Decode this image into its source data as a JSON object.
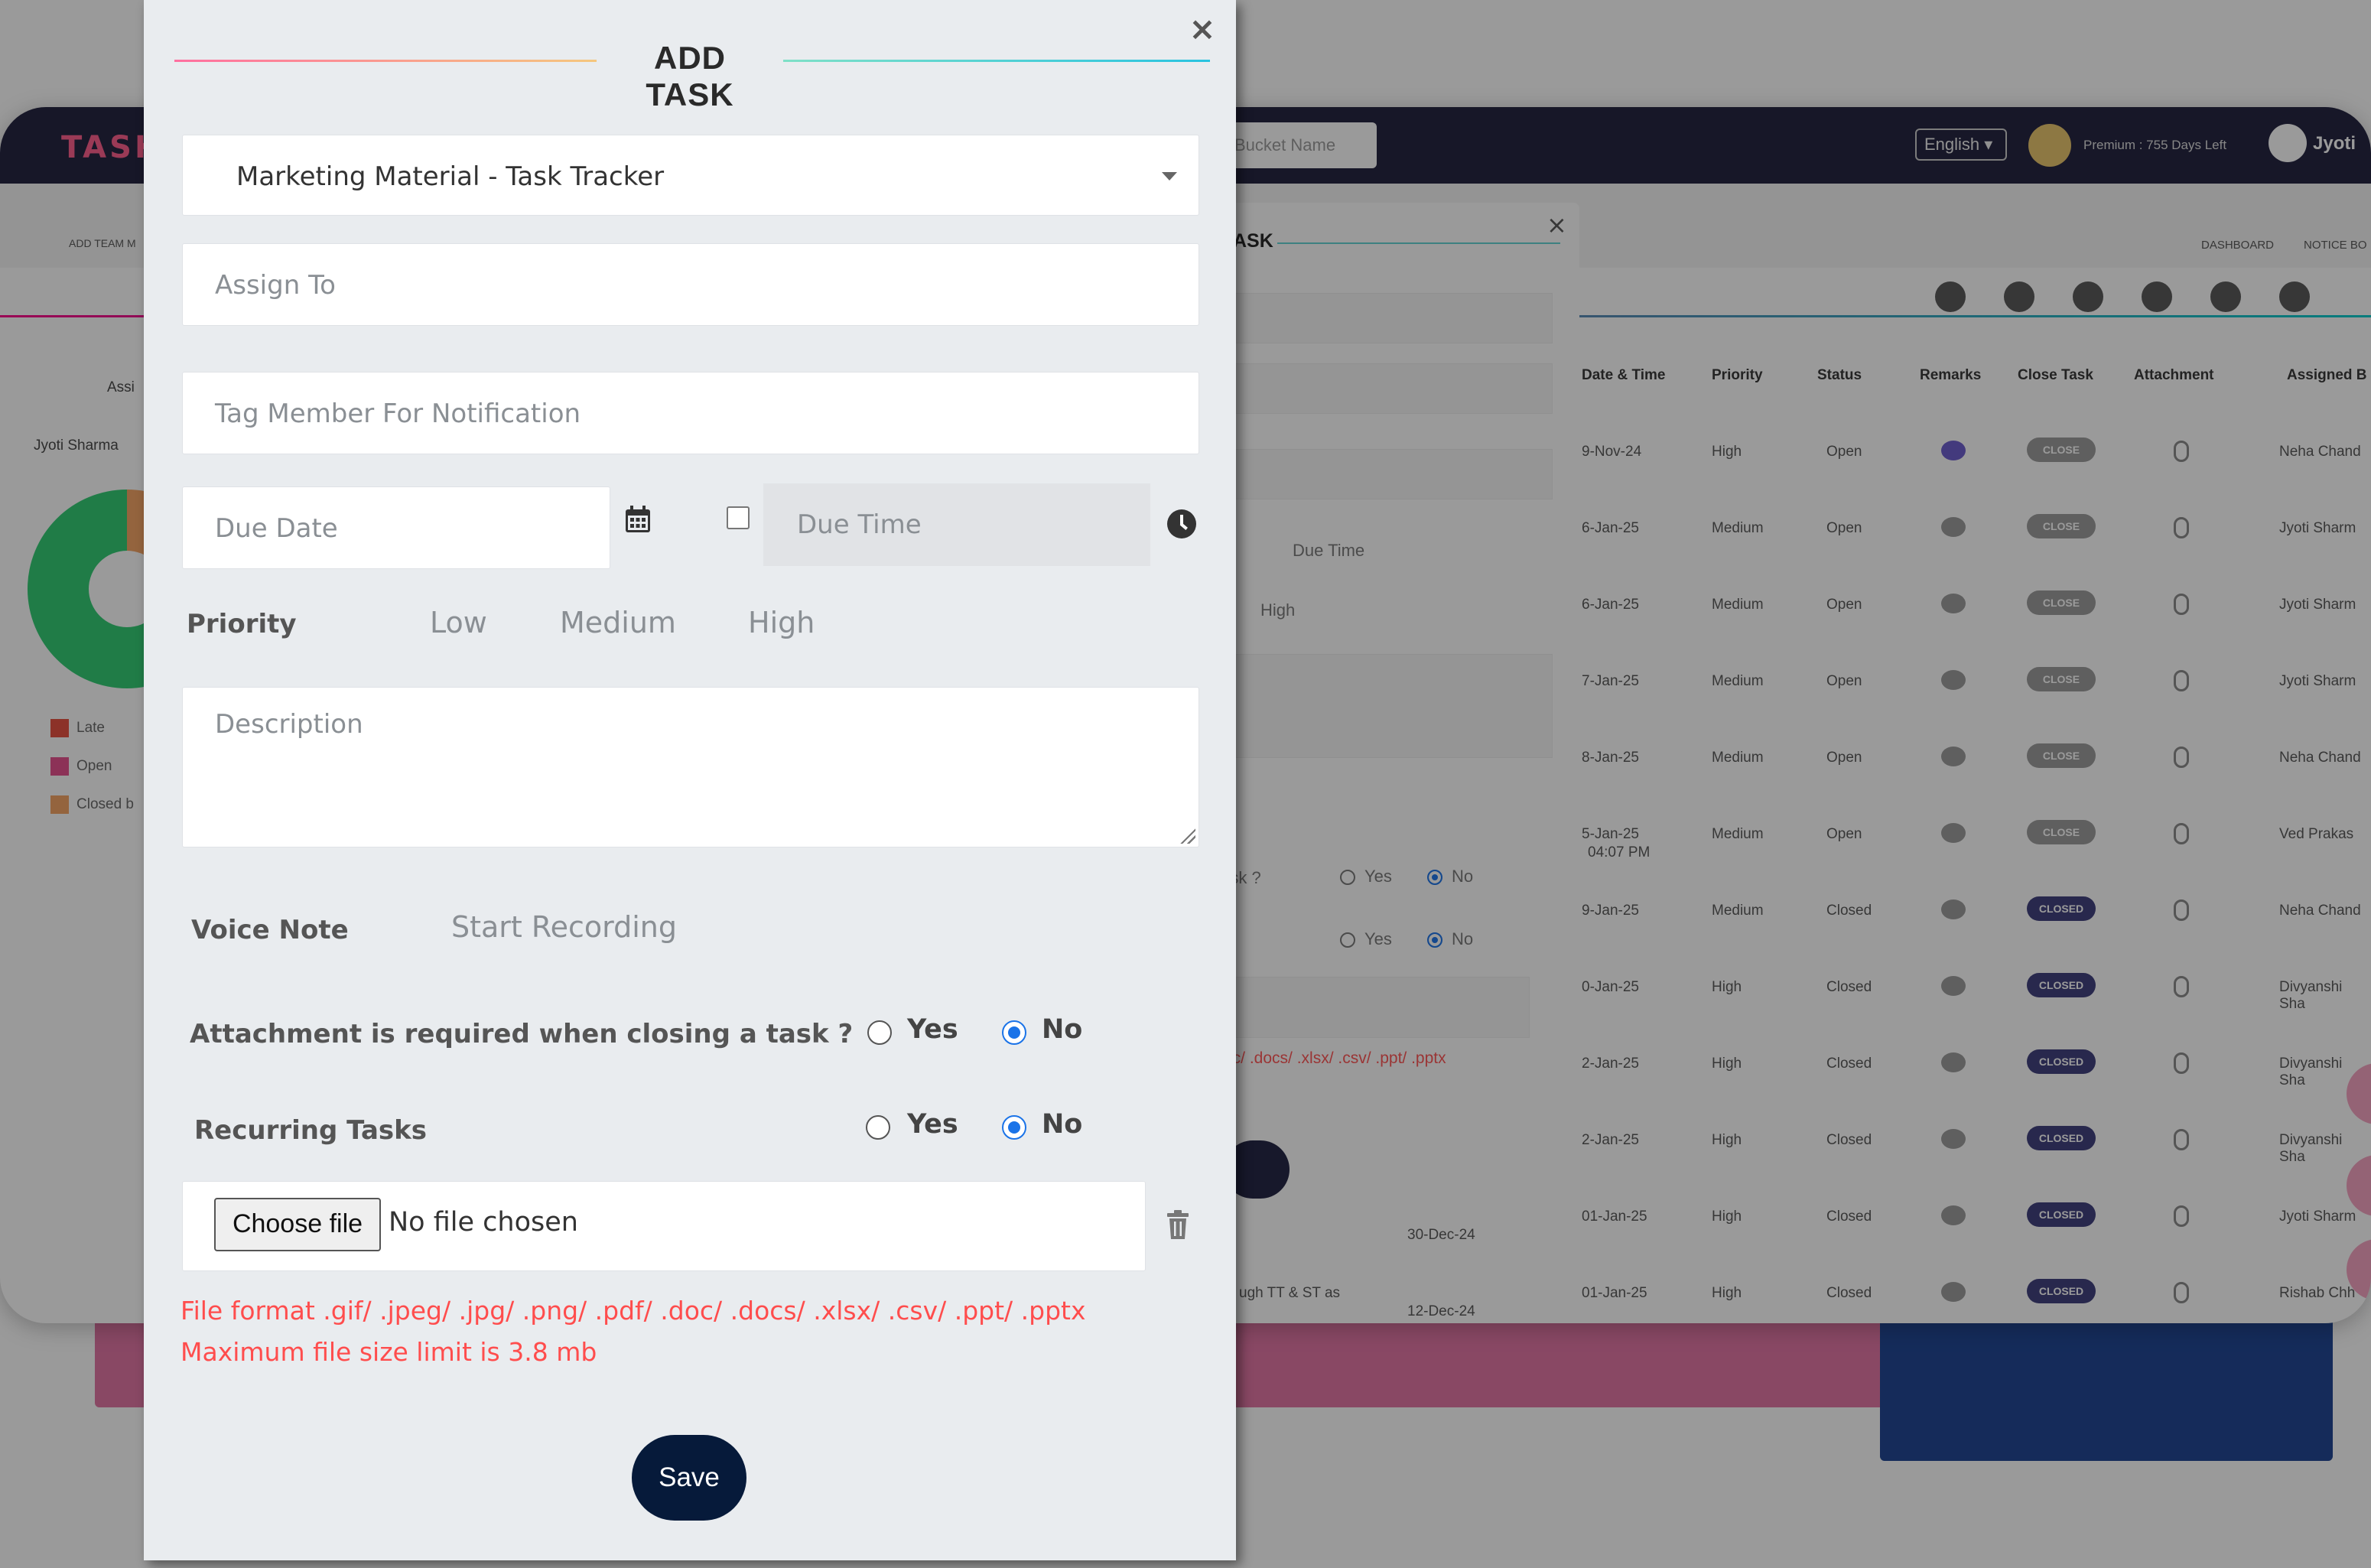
{
  "background": {
    "logo": "TASK",
    "bucket_placeholder": "Bucket Name",
    "language": "English",
    "premium_text": "Premium : 755 Days Left",
    "user_name": "Jyoti",
    "add_team_label": "ADD TEAM M",
    "dashboard_label": "DASHBOARD",
    "notice_label": "NOTICE BO",
    "left_heading": "Assi",
    "left_user": "Jyoti Sharma",
    "legend": [
      "Late",
      "Open",
      "Closed b"
    ],
    "legend_colors": [
      "#e74c3c",
      "#e74c8c",
      "#f4a261"
    ],
    "table_headers": [
      "Date & Time",
      "Priority",
      "Status",
      "Remarks",
      "Close Task",
      "Attachment",
      "Assigned B"
    ],
    "table_rows": [
      {
        "date": "9-Nov-24",
        "priority": "High",
        "status": "Open",
        "close": "CLOSE",
        "assigned": "Neha Chand"
      },
      {
        "date": "6-Jan-25",
        "priority": "Medium",
        "status": "Open",
        "close": "CLOSE",
        "assigned": "Jyoti Sharm"
      },
      {
        "date": "6-Jan-25",
        "priority": "Medium",
        "status": "Open",
        "close": "CLOSE",
        "assigned": "Jyoti Sharm"
      },
      {
        "date": "7-Jan-25",
        "priority": "Medium",
        "status": "Open",
        "close": "CLOSE",
        "assigned": "Jyoti Sharm"
      },
      {
        "date": "8-Jan-25",
        "priority": "Medium",
        "status": "Open",
        "close": "CLOSE",
        "assigned": "Neha Chand"
      },
      {
        "date": "5-Jan-25",
        "priority": "Medium",
        "status": "Open",
        "close": "CLOSE",
        "assigned": "Ved Prakas"
      },
      {
        "date": "9-Jan-25",
        "priority": "Medium",
        "status": "Closed",
        "close": "CLOSED",
        "assigned": "Neha Chand"
      },
      {
        "date": "0-Jan-25",
        "priority": "High",
        "status": "Closed",
        "close": "CLOSED",
        "assigned": "Divyanshi Sha"
      },
      {
        "date": "2-Jan-25",
        "priority": "High",
        "status": "Closed",
        "close": "CLOSED",
        "assigned": "Divyanshi Sha"
      },
      {
        "date": "2-Jan-25",
        "priority": "High",
        "status": "Closed",
        "close": "CLOSED",
        "assigned": "Divyanshi Sha"
      },
      {
        "date": "01-Jan-25",
        "priority": "High",
        "status": "Closed",
        "close": "CLOSED",
        "assigned": "Jyoti Sharm"
      },
      {
        "date": "01-Jan-25",
        "priority": "High",
        "status": "Closed",
        "close": "CLOSED",
        "assigned": "Rishab Chh"
      }
    ],
    "extra_dates": [
      "30-Dec-24",
      "12-Dec-24"
    ],
    "extra_text": "ugh TT & ST as",
    "row5_time": "04:07 PM",
    "dialog2": {
      "title": "ASK",
      "due_time": "Due Time",
      "high": "High",
      "question": "task ?",
      "yes": "Yes",
      "no": "No",
      "formats": "oc/ .docs/ .xlsx/ .csv/ .ppt/ .pptx"
    }
  },
  "modal": {
    "title": "ADD TASK",
    "close_icon": "close-icon",
    "project_select": "Marketing Material - Task Tracker",
    "assign_to_placeholder": "Assign To",
    "tag_member_placeholder": "Tag Member For Notification",
    "due_date_placeholder": "Due Date",
    "due_time_placeholder": "Due Time",
    "priority": {
      "label": "Priority",
      "options": [
        "Low",
        "Medium",
        "High"
      ]
    },
    "description_placeholder": "Description",
    "voice_note": {
      "label": "Voice Note",
      "action": "Start Recording"
    },
    "attachment_required": {
      "question": "Attachment is required when closing a task ?",
      "yes": "Yes",
      "no": "No",
      "selected": "No"
    },
    "recurring": {
      "question": "Recurring Tasks",
      "yes": "Yes",
      "no": "No",
      "selected": "No"
    },
    "file": {
      "button": "Choose file",
      "status": "No file chosen",
      "format_note": "File format .gif/ .jpeg/ .jpg/ .png/ .pdf/ .doc/ .docs/ .xlsx/ .csv/ .ppt/ .pptx",
      "size_note": "Maximum file size limit is 3.8 mb"
    },
    "save_label": "Save"
  },
  "colors": {
    "accent_blue": "#1a73e8",
    "save_bg": "#061a3a",
    "error_red": "#ff4d4d",
    "pink_strip": "#e272a3",
    "blue_strip": "#1a4192"
  }
}
